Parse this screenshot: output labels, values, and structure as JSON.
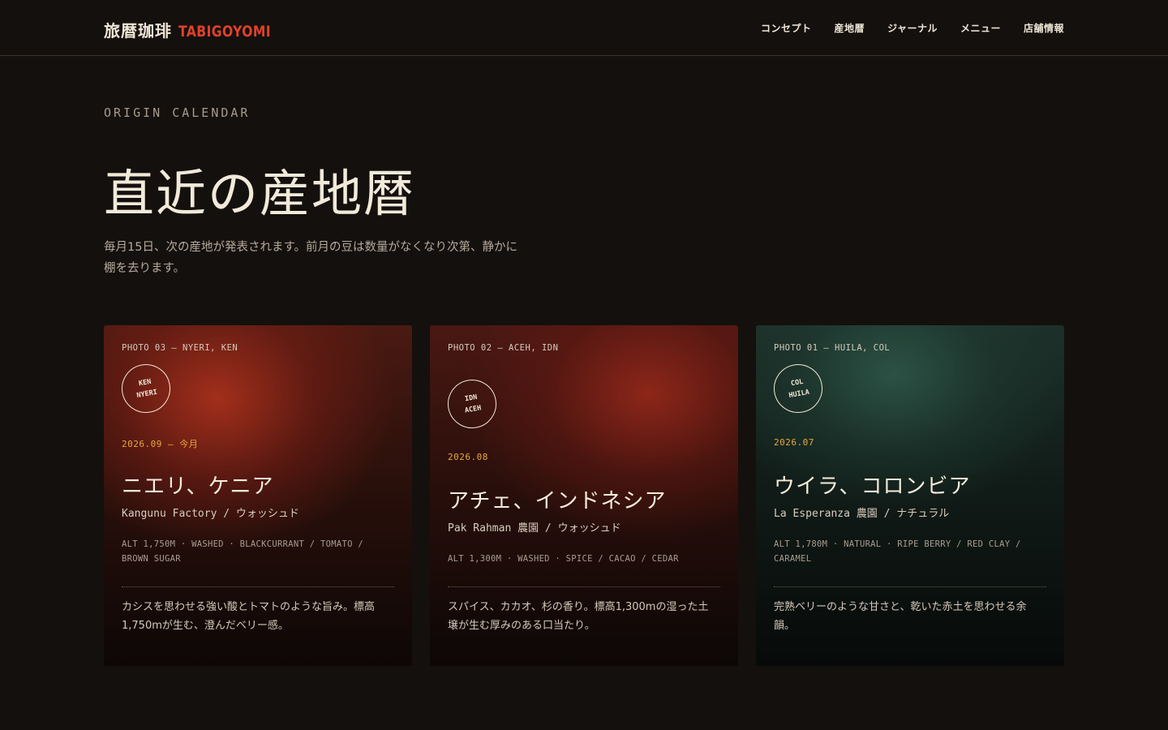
{
  "header": {
    "brand_jp": "旅暦珈琲",
    "brand_en": "TABIGOYOMI",
    "nav": [
      "コンセプト",
      "産地暦",
      "ジャーナル",
      "メニュー",
      "店舗情報"
    ]
  },
  "hero": {
    "eyebrow": "ORIGIN CALENDAR",
    "title": "直近の産地暦",
    "lead": "毎月15日、次の産地が発表されます。前月の豆は数量がなくなり次第、静かに棚を去ります。"
  },
  "cards": [
    {
      "photo": "PHOTO 03 — NYERI, KEN",
      "stamp_top": "KEN",
      "stamp_bottom": "NYERI",
      "date": "2026.09 — 今月",
      "name": "ニエリ、ケニア",
      "producer": "Kangunu Factory / ウォッシュド",
      "spec": "ALT 1,750M · WASHED · BLACKCURRANT / TOMATO / BROWN SUGAR",
      "note": "カシスを思わせる強い酸とトマトのような旨み。標高1,750mが生む、澄んだベリー感。"
    },
    {
      "photo": "PHOTO 02 — ACEH, IDN",
      "stamp_top": "IDN",
      "stamp_bottom": "ACEH",
      "date": "2026.08",
      "name": "アチェ、インドネシア",
      "producer": "Pak Rahman 農園 / ウォッシュド",
      "spec": "ALT 1,300M · WASHED · SPICE / CACAO / CEDAR",
      "note": "スパイス、カカオ、杉の香り。標高1,300mの湿った土壌が生む厚みのある口当たり。"
    },
    {
      "photo": "PHOTO 01 — HUILA, COL",
      "stamp_top": "COL",
      "stamp_bottom": "HUILA",
      "date": "2026.07",
      "name": "ウイラ、コロンビア",
      "producer": "La Esperanza 農園 / ナチュラル",
      "spec": "ALT 1,780M · NATURAL · RIPE BERRY / RED CLAY / CARAMEL",
      "note": "完熟ベリーのような甘さと、乾いた赤土を思わせる余韻。"
    }
  ],
  "colors": {
    "background": "#14100e",
    "accent_red": "#e0412a",
    "date_amber": "#e9a93a"
  }
}
